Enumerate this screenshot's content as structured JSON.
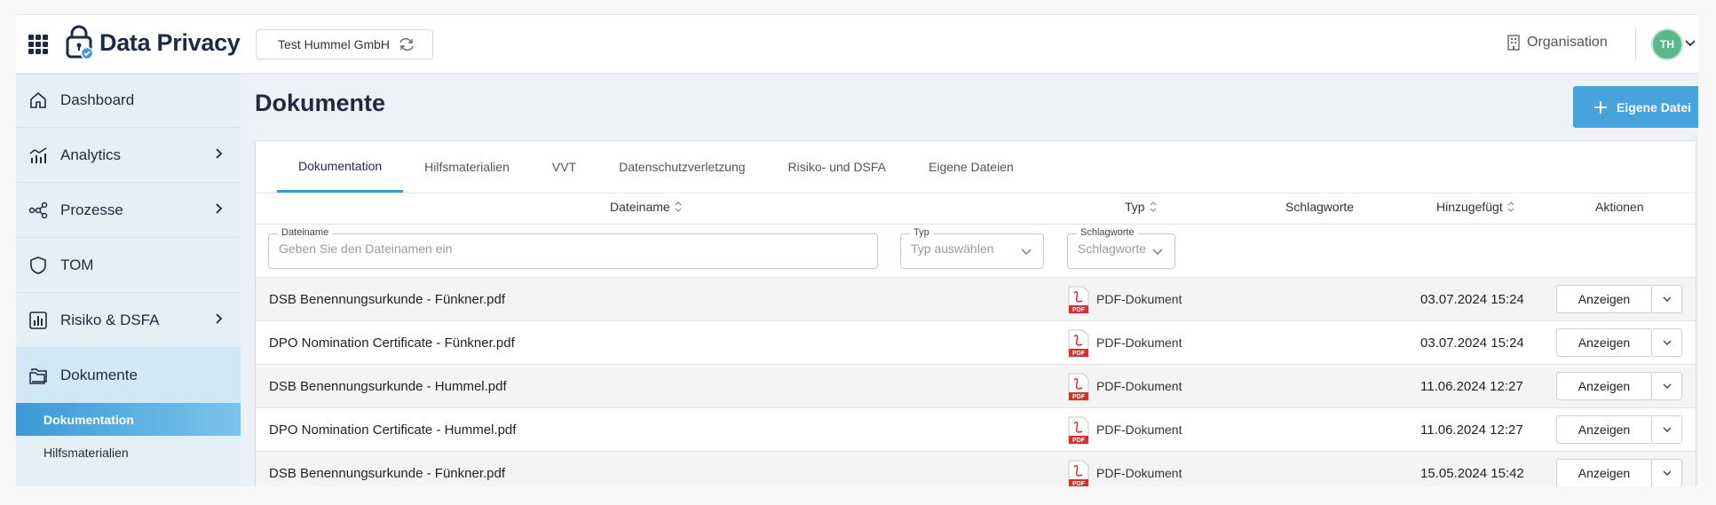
{
  "header": {
    "app_title": "Data Privacy",
    "org_switcher_label": "Test Hummel GmbH",
    "org_link_label": "Organisation",
    "avatar_initials": "TH",
    "brand_color": "#1e2a44",
    "avatar_color": "#5db889"
  },
  "sidebar": {
    "items": [
      {
        "label": "Dashboard",
        "icon": "home-icon",
        "has_chevron": false
      },
      {
        "label": "Analytics",
        "icon": "analytics-icon",
        "has_chevron": true
      },
      {
        "label": "Prozesse",
        "icon": "process-icon",
        "has_chevron": true
      },
      {
        "label": "TOM",
        "icon": "shield-icon",
        "has_chevron": false
      },
      {
        "label": "Risiko & DSFA",
        "icon": "bar-chart-icon",
        "has_chevron": true
      },
      {
        "label": "Dokumente",
        "icon": "folder-icon",
        "has_chevron": false
      }
    ],
    "subitems": [
      {
        "label": "Dokumentation",
        "active": true
      },
      {
        "label": "Hilfsmaterialien",
        "active": false
      }
    ],
    "active_color": "#3a9ad6"
  },
  "main": {
    "page_title": "Dokumente",
    "primary_button_label": "Eigene Datei",
    "tabs": [
      {
        "label": "Dokumentation"
      },
      {
        "label": "Hilfsmaterialien"
      },
      {
        "label": "VVT"
      },
      {
        "label": "Datenschutzverletzung"
      },
      {
        "label": "Risiko- und DSFA"
      },
      {
        "label": "Eigene Dateien"
      }
    ],
    "active_tab": "Dokumentation",
    "columns": {
      "name": "Dateiname",
      "type": "Typ",
      "tags": "Schlagworte",
      "added": "Hinzugefügt",
      "actions": "Aktionen"
    },
    "filters": {
      "name_label": "Dateiname",
      "name_placeholder": "Geben Sie den Dateinamen ein",
      "type_label": "Typ",
      "type_placeholder": "Typ auswählen",
      "tags_label": "Schlagworte",
      "tags_placeholder": "Schlagworte au"
    },
    "rows": [
      {
        "name": "DSB Benennungsurkunde - Fünkner.pdf",
        "type": "PDF-Dokument",
        "date": "03.07.2024 15:24",
        "action": "Anzeigen"
      },
      {
        "name": "DPO Nomination Certificate - Fünkner.pdf",
        "type": "PDF-Dokument",
        "date": "03.07.2024 15:24",
        "action": "Anzeigen"
      },
      {
        "name": "DSB Benennungsurkunde - Hummel.pdf",
        "type": "PDF-Dokument",
        "date": "11.06.2024 12:27",
        "action": "Anzeigen"
      },
      {
        "name": "DPO Nomination Certificate - Hummel.pdf",
        "type": "PDF-Dokument",
        "date": "11.06.2024 12:27",
        "action": "Anzeigen"
      },
      {
        "name": "DSB Benennungsurkunde - Fünkner.pdf",
        "type": "PDF-Dokument",
        "date": "15.05.2024 15:42",
        "action": "Anzeigen"
      }
    ],
    "primary_button_color": "#47a3dc"
  }
}
